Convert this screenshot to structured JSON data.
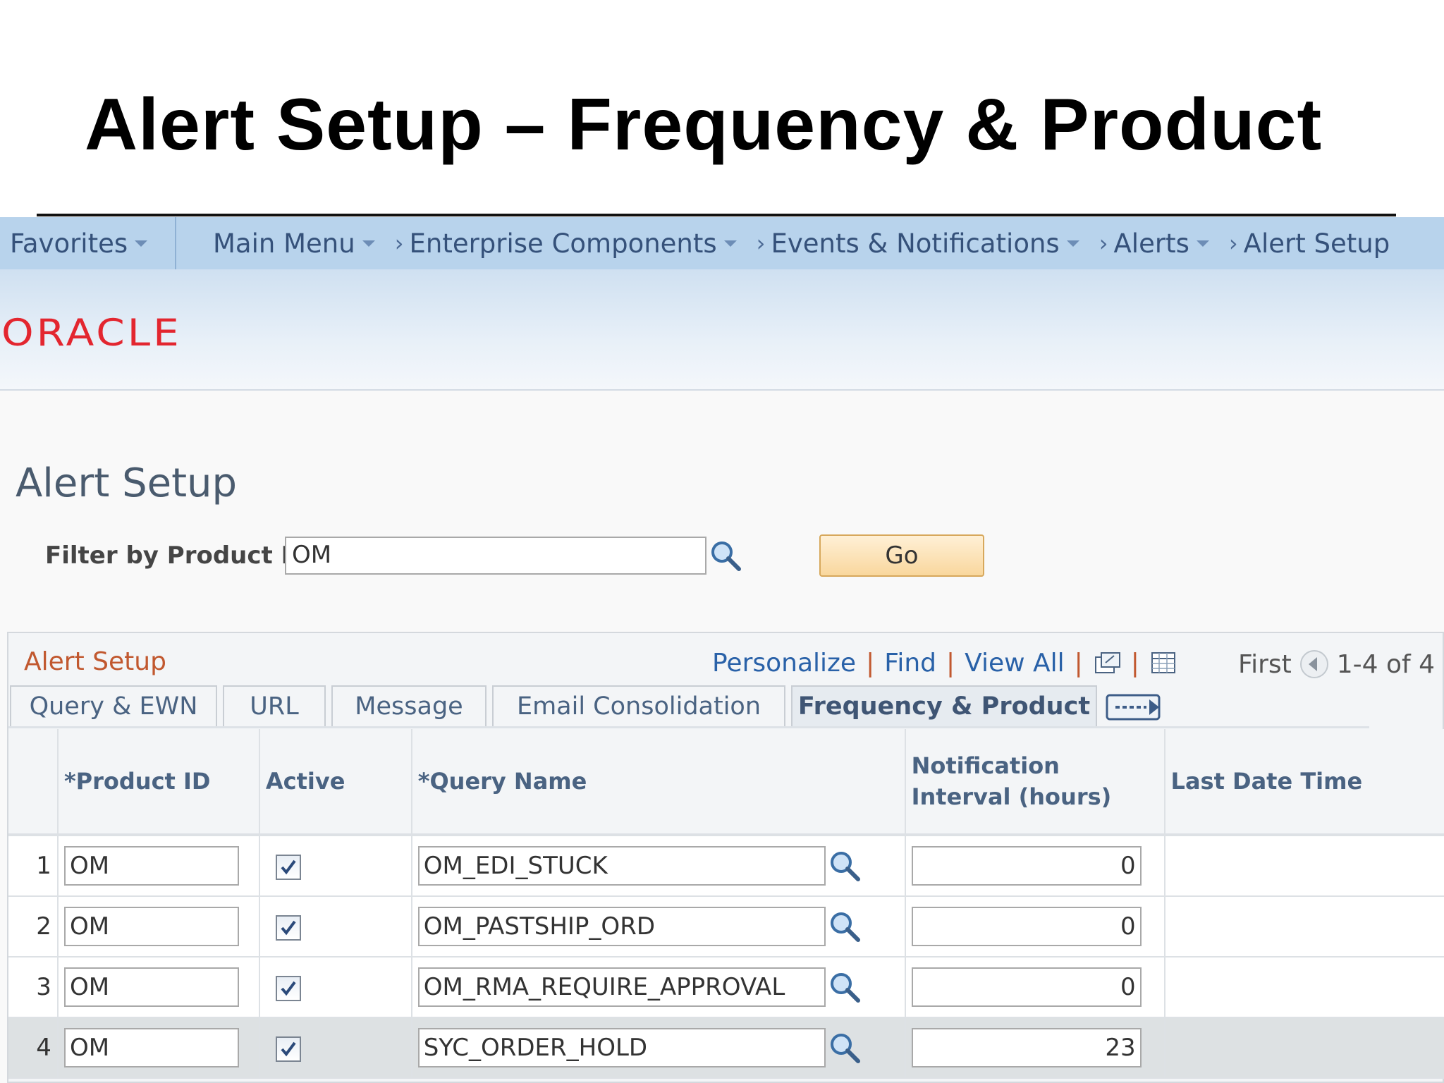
{
  "slide": {
    "title": "Alert Setup – Frequency & Product"
  },
  "navbar": {
    "favorites": "Favorites",
    "main_menu": "Main Menu",
    "breadcrumbs": [
      "Enterprise Components",
      "Events & Notifications",
      "Alerts",
      "Alert Setup"
    ]
  },
  "banner": {
    "logo_text": "ORACLE",
    "logo_color": "#e3262f"
  },
  "page": {
    "title": "Alert Setup",
    "filter_label": "Filter by Product ID",
    "filter_value": "OM",
    "go_label": "Go"
  },
  "grid": {
    "title": "Alert Setup",
    "tools": {
      "personalize": "Personalize",
      "find": "Find",
      "view_all": "View All"
    },
    "nav": {
      "first": "First",
      "range": "1-4 of 4"
    },
    "tabs": [
      "Query & EWN",
      "URL",
      "Message",
      "Email Consolidation",
      "Frequency & Product"
    ],
    "active_tab": "Frequency & Product",
    "columns": [
      "*Product ID",
      "Active",
      "*Query Name",
      "Notification Interval (hours)",
      "Last Date Time"
    ],
    "rows": [
      {
        "num": "1",
        "product_id": "OM",
        "active": true,
        "query_name": "OM_EDI_STUCK",
        "interval": "0",
        "last_date_time": ""
      },
      {
        "num": "2",
        "product_id": "OM",
        "active": true,
        "query_name": "OM_PASTSHIP_ORD",
        "interval": "0",
        "last_date_time": ""
      },
      {
        "num": "3",
        "product_id": "OM",
        "active": true,
        "query_name": "OM_RMA_REQUIRE_APPROVAL",
        "interval": "0",
        "last_date_time": ""
      },
      {
        "num": "4",
        "product_id": "OM",
        "active": true,
        "query_name": "SYC_ORDER_HOLD",
        "interval": "23",
        "last_date_time": ""
      }
    ]
  }
}
